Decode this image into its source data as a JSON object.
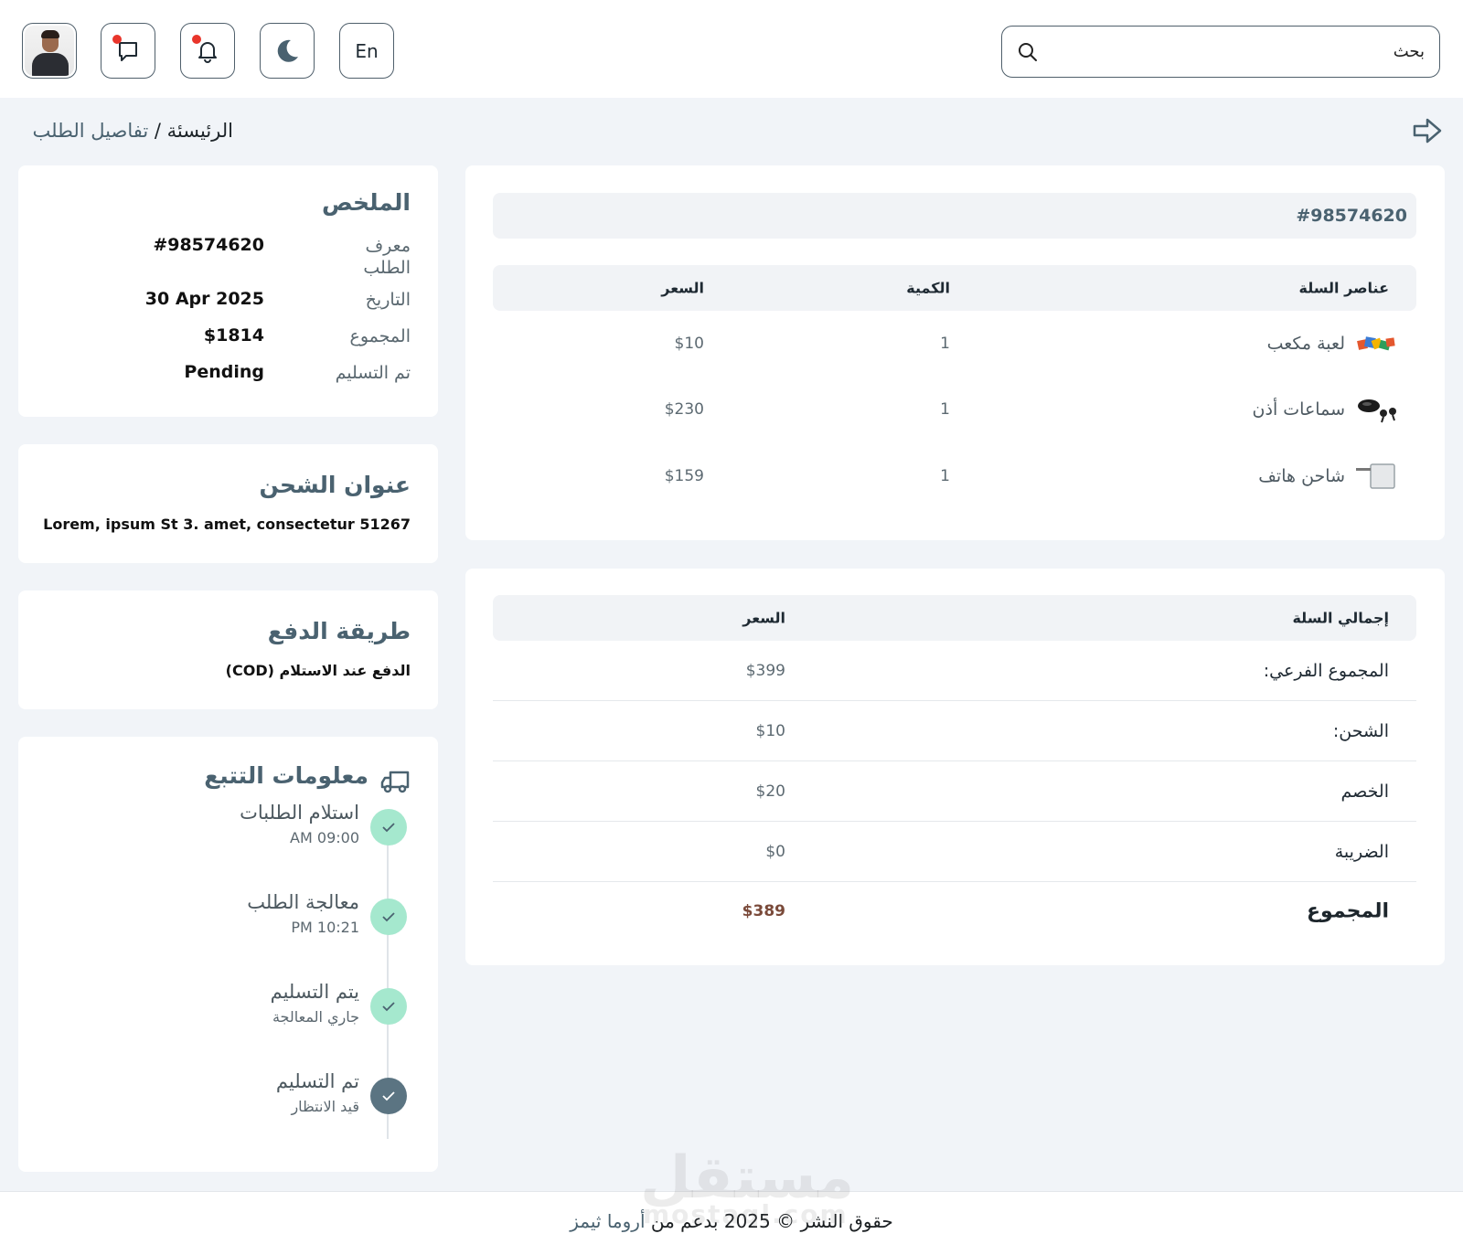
{
  "header": {
    "search_placeholder": "بحث",
    "language_label": "En",
    "icons": [
      "search-icon",
      "moon-icon",
      "bell-icon",
      "chat-icon",
      "avatar"
    ]
  },
  "breadcrumb": {
    "home": "الرئيسئة",
    "separator": "/",
    "current": "تفاصيل الطلب"
  },
  "order": {
    "id": "#98574620",
    "columns": {
      "item": "عناصر السلة",
      "qty": "الكمية",
      "price": "السعر"
    },
    "items": [
      {
        "name": "لعبة مكعب",
        "qty": "1",
        "price": "$10",
        "icon": "cube-toy-thumbnail"
      },
      {
        "name": "سماعات أذن",
        "qty": "1",
        "price": "$230",
        "icon": "earbuds-thumbnail"
      },
      {
        "name": "شاحن هاتف",
        "qty": "1",
        "price": "$159",
        "icon": "charger-thumbnail"
      }
    ]
  },
  "totals": {
    "columns": {
      "label": "إجمالي السلة",
      "price": "السعر"
    },
    "rows": [
      {
        "label": "المجموع الفرعي:",
        "value": "$399"
      },
      {
        "label": "الشحن:",
        "value": "$10"
      },
      {
        "label": "الخصم",
        "value": "$20"
      },
      {
        "label": "الضريبة",
        "value": "$0"
      },
      {
        "label": "المجموع",
        "value": "$389"
      }
    ]
  },
  "summary": {
    "title": "الملخص",
    "rows": [
      {
        "label": "معرف الطلب",
        "value": "#98574620"
      },
      {
        "label": "التاريخ",
        "value": "30 Apr 2025"
      },
      {
        "label": "المجموع",
        "value": "$1814"
      },
      {
        "label": "تم التسليم",
        "value": "Pending"
      }
    ]
  },
  "shipping": {
    "title": "عنوان الشحن",
    "address": "Lorem, ipsum St 3. amet, consectetur 51267"
  },
  "payment": {
    "title": "طريقة الدفع",
    "method": "الدفع عند الاستلام (COD)"
  },
  "tracking": {
    "title": "معلومات التتبع",
    "steps": [
      {
        "title": "استلام الطلبات",
        "sub": "09:00 AM",
        "state": "complete"
      },
      {
        "title": "معالجة الطلب",
        "sub": "10:21 PM",
        "state": "complete"
      },
      {
        "title": "يتم التسليم",
        "sub": "جاري المعالجة",
        "state": "complete"
      },
      {
        "title": "تم التسليم",
        "sub": "قيد الانتظار",
        "state": "current"
      }
    ]
  },
  "footer": {
    "text": "حقوق النشر © 2025 بدعم من",
    "brand": "أروما ثيمز"
  },
  "watermark": {
    "main": "مستقل",
    "sub": "mostaql.com"
  },
  "colors": {
    "accent": "#4a6270",
    "step_complete": "#a5e8ce",
    "step_current": "#5b7482",
    "notification_dot": "#e9352b",
    "page_bg": "#f1f4f8"
  }
}
